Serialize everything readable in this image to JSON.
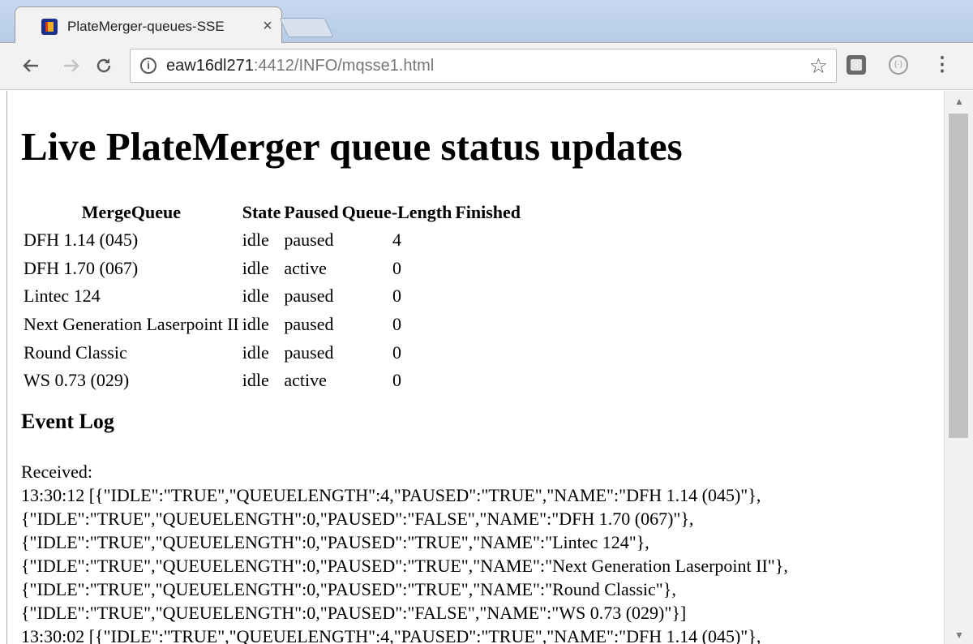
{
  "browser": {
    "tab_title": "PlateMerger-queues-SSE",
    "tab_close": "×",
    "url_host": "eaw16dl271",
    "url_rest": ":4412/INFO/mqsse1.html",
    "icons": {
      "back": "arrow-left",
      "forward": "arrow-right",
      "reload": "reload",
      "info": "info",
      "bookmark": "star",
      "extension_1": "square-extension",
      "extension_2": "circle-extension",
      "menu": "kebab-menu"
    }
  },
  "page": {
    "title": "Live PlateMerger queue status updates",
    "table": {
      "headers": [
        "MergeQueue",
        "State",
        "Paused",
        "Queue-Length",
        "Finished"
      ],
      "rows": [
        {
          "name": "DFH 1.14 (045)",
          "state": "idle",
          "paused": "paused",
          "queue_length": "4",
          "finished": ""
        },
        {
          "name": "DFH 1.70 (067)",
          "state": "idle",
          "paused": "active",
          "queue_length": "0",
          "finished": ""
        },
        {
          "name": "Lintec 124",
          "state": "idle",
          "paused": "paused",
          "queue_length": "0",
          "finished": ""
        },
        {
          "name": "Next Generation Laserpoint II",
          "state": "idle",
          "paused": "paused",
          "queue_length": "0",
          "finished": ""
        },
        {
          "name": "Round Classic",
          "state": "idle",
          "paused": "paused",
          "queue_length": "0",
          "finished": ""
        },
        {
          "name": "WS 0.73 (029)",
          "state": "idle",
          "paused": "active",
          "queue_length": "0",
          "finished": ""
        }
      ]
    },
    "event_log": {
      "title": "Event Log",
      "lines": [
        "Received:",
        "13:30:12 [{\"IDLE\":\"TRUE\",\"QUEUELENGTH\":4,\"PAUSED\":\"TRUE\",\"NAME\":\"DFH 1.14 (045)\"},",
        "{\"IDLE\":\"TRUE\",\"QUEUELENGTH\":0,\"PAUSED\":\"FALSE\",\"NAME\":\"DFH 1.70 (067)\"},",
        "{\"IDLE\":\"TRUE\",\"QUEUELENGTH\":0,\"PAUSED\":\"TRUE\",\"NAME\":\"Lintec 124\"},",
        "{\"IDLE\":\"TRUE\",\"QUEUELENGTH\":0,\"PAUSED\":\"TRUE\",\"NAME\":\"Next Generation Laserpoint II\"},",
        "{\"IDLE\":\"TRUE\",\"QUEUELENGTH\":0,\"PAUSED\":\"TRUE\",\"NAME\":\"Round Classic\"},",
        "{\"IDLE\":\"TRUE\",\"QUEUELENGTH\":0,\"PAUSED\":\"FALSE\",\"NAME\":\"WS 0.73 (029)\"}]",
        "13:30:02 [{\"IDLE\":\"TRUE\",\"QUEUELENGTH\":4,\"PAUSED\":\"TRUE\",\"NAME\":\"DFH 1.14 (045)\"},"
      ]
    }
  }
}
